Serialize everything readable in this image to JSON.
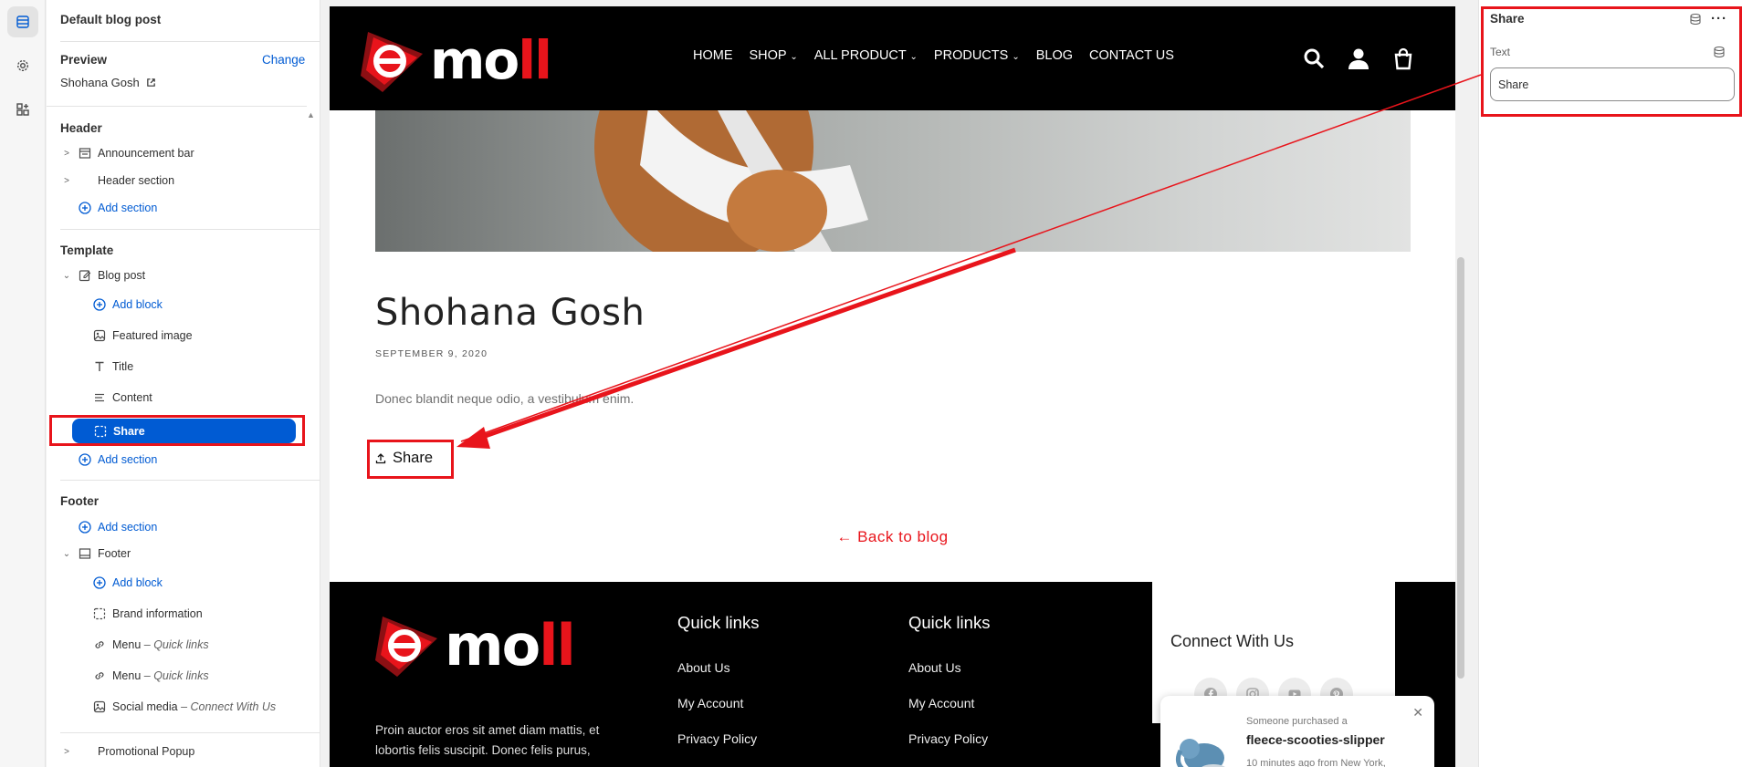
{
  "left_panel": {
    "title": "Default blog post",
    "preview_label": "Preview",
    "change_label": "Change",
    "preview_value": "Shohana Gosh",
    "header_group": "Header",
    "announcement_bar": "Announcement bar",
    "header_section": "Header section",
    "add_section": "Add section",
    "template_group": "Template",
    "blog_post": "Blog post",
    "add_block": "Add block",
    "featured_image": "Featured image",
    "title_item": "Title",
    "content_item": "Content",
    "share_item": "Share",
    "footer_group": "Footer",
    "footer_item": "Footer",
    "brand_information": "Brand information",
    "menu_1": "Menu",
    "menu_1_sub": "– Quick links",
    "menu_2": "Menu",
    "menu_2_sub": "– Quick links",
    "social_media": "Social media",
    "social_media_sub": "– Connect With Us",
    "promotional_popup": "Promotional Popup"
  },
  "site": {
    "logo_letter": "e",
    "logo_text_white": "mo",
    "logo_text_red": "ll",
    "nav": [
      "HOME",
      "SHOP",
      "ALL PRODUCT",
      "PRODUCTS",
      "BLOG",
      "CONTACT US"
    ],
    "nav_dropdown": [
      false,
      true,
      true,
      true,
      false,
      false
    ],
    "post_title": "Shohana Gosh",
    "post_date": "SEPTEMBER 9, 2020",
    "post_body": "Donec blandit neque odio, a vestibulum enim.",
    "share_label": "Share",
    "back_label": "Back to blog",
    "footer": {
      "col1_title": "Quick links",
      "col2_title": "Quick links",
      "links": [
        "About Us",
        "My Account",
        "Privacy Policy"
      ],
      "description": "Proin auctor eros sit amet diam mattis, et lobortis felis suscipit. Donec felis purus,",
      "connect_title": "Connect With Us",
      "social": [
        "facebook-icon",
        "instagram-icon",
        "youtube-icon",
        "pinterest-icon"
      ]
    },
    "toast": {
      "small": "Someone purchased a",
      "product": "fleece-scooties-slipper",
      "time": "10 minutes ago from New York,"
    }
  },
  "right_panel": {
    "title": "Share",
    "field_label": "Text",
    "field_value": "Share"
  },
  "colors": {
    "accent": "#005bd3",
    "brand_red": "#e8141b",
    "annotation": "#e8141b"
  }
}
